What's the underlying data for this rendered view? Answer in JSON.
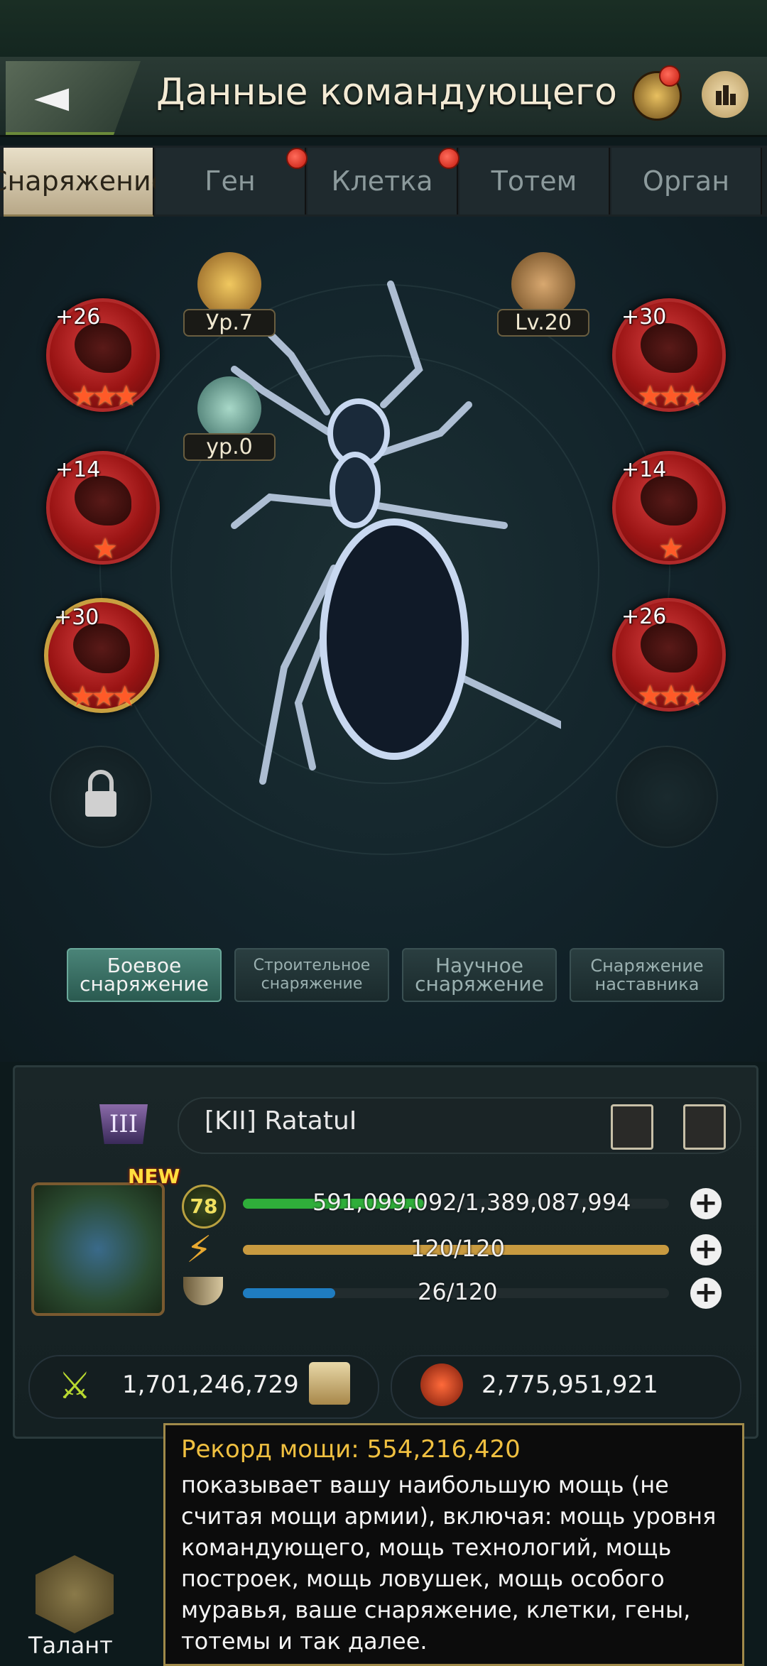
{
  "header": {
    "title": "Данные командующего",
    "back_icon": "◄"
  },
  "tabs": [
    {
      "label": "Снаряжение",
      "active": true,
      "dot": false
    },
    {
      "label": "Ген",
      "active": false,
      "dot": true
    },
    {
      "label": "Клетка",
      "active": false,
      "dot": true
    },
    {
      "label": "Тотем",
      "active": false,
      "dot": false
    },
    {
      "label": "Орган",
      "active": false,
      "dot": false
    }
  ],
  "badges": {
    "left_top": "Ур.7",
    "left_mid": "ур.0",
    "right_top": "Lv.20"
  },
  "slots": {
    "l1": {
      "plus": "+26",
      "stars": "★★★"
    },
    "l2": {
      "plus": "+14",
      "stars": "★"
    },
    "l3": {
      "plus": "+30",
      "stars": "★★★"
    },
    "r1": {
      "plus": "+30",
      "stars": "★★★"
    },
    "r2": {
      "plus": "+14",
      "stars": "★"
    },
    "r3": {
      "plus": "+26",
      "stars": "★★★"
    }
  },
  "categories": [
    {
      "line1": "Боевое",
      "line2": "снаряжение",
      "active": true
    },
    {
      "line1": "Строительное",
      "line2": "снаряжение",
      "active": false
    },
    {
      "line1": "Научное",
      "line2": "снаряжение",
      "active": false
    },
    {
      "line1": "Снаряжение",
      "line2": "наставника",
      "active": false
    }
  ],
  "profile": {
    "rank": "III",
    "name": "[KII]   RatatuI",
    "new_badge": "NEW",
    "level": "78",
    "stats": [
      {
        "text": "591,099,092/1,389,087,994",
        "fill": 0.4255,
        "color": "#2fae3a"
      },
      {
        "text": "120/120",
        "fill": 1.0,
        "color": "#c89a40"
      },
      {
        "text": "26/120",
        "fill": 0.2167,
        "color": "#1f7cc0"
      }
    ],
    "power": "1,701,246,729",
    "kills": "2,775,951,921"
  },
  "tooltip": {
    "title": "Рекорд мощи: 554,216,420",
    "body": "показывает вашу наибольшую мощь (не считая мощи армии), включая: мощь уровня командующего, мощь технологий, мощь построек, мощь ловушек, мощь особого муравья, ваше снаряжение, клетки, гены, тотемы и так далее."
  },
  "talent": {
    "label": "Талант"
  }
}
